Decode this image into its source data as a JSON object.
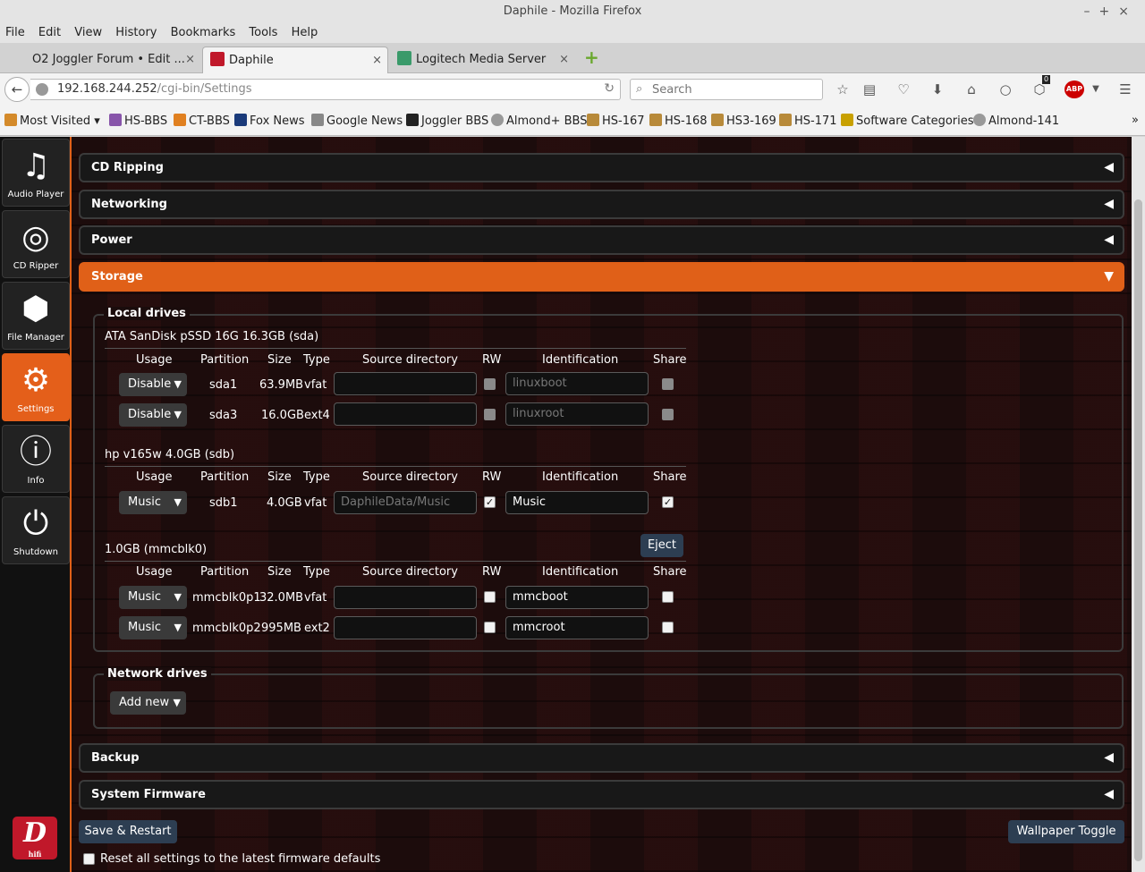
{
  "window": {
    "title": "Daphile - Mozilla Firefox"
  },
  "menu": [
    "File",
    "Edit",
    "View",
    "History",
    "Bookmarks",
    "Tools",
    "Help"
  ],
  "tabs": [
    {
      "label": "O2 Joggler Forum • Edit ..."
    },
    {
      "label": "Daphile"
    },
    {
      "label": "Logitech Media Server"
    }
  ],
  "nav": {
    "url_host": "192.168.244.252",
    "url_path": "/cgi-bin/Settings",
    "search_placeholder": "Search",
    "badge": "0"
  },
  "bookmarks": [
    "Most Visited",
    "HS-BBS",
    "CT-BBS",
    "Fox News",
    "Google News",
    "Joggler BBS",
    "Almond+ BBS",
    "HS-167",
    "HS-168",
    "HS3-169",
    "HS-171",
    "Software Categories",
    "Almond-141"
  ],
  "sidebar": [
    {
      "label": "Audio Player"
    },
    {
      "label": "CD Ripper"
    },
    {
      "label": "File Manager"
    },
    {
      "label": "Settings"
    },
    {
      "label": "Info"
    },
    {
      "label": "Shutdown"
    }
  ],
  "logo": {
    "text": "D",
    "sub": "hifi"
  },
  "sections": {
    "cd_ripping": "CD Ripping",
    "networking": "Networking",
    "power": "Power",
    "storage": "Storage",
    "backup": "Backup",
    "firmware": "System Firmware"
  },
  "storage": {
    "local_legend": "Local drives",
    "network_legend": "Network drives",
    "headers": {
      "usage": "Usage",
      "partition": "Partition",
      "size": "Size",
      "type": "Type",
      "source": "Source directory",
      "rw": "RW",
      "ident": "Identification",
      "share": "Share"
    },
    "drives": [
      {
        "title": "ATA SanDisk pSSD 16G 16.3GB (sda)",
        "rows": [
          {
            "usage": "Disable",
            "partition": "sda1",
            "size": "63.9MB",
            "type": "vfat",
            "source": "",
            "ident": "linuxboot"
          },
          {
            "usage": "Disable",
            "partition": "sda3",
            "size": "16.0GB",
            "type": "ext4",
            "source": "",
            "ident": "linuxroot"
          }
        ]
      },
      {
        "title": "hp v165w 4.0GB (sdb)",
        "rows": [
          {
            "usage": "Music",
            "partition": "sdb1",
            "size": "4.0GB",
            "type": "vfat",
            "source": "DaphileData/Music",
            "ident": "Music"
          }
        ]
      },
      {
        "title": "1.0GB (mmcblk0)",
        "eject": "Eject",
        "rows": [
          {
            "usage": "Music",
            "partition": "mmcblk0p1",
            "size": "32.0MB",
            "type": "vfat",
            "source": "",
            "ident": "mmcboot"
          },
          {
            "usage": "Music",
            "partition": "mmcblk0p2",
            "size": "995MB",
            "type": "ext2",
            "source": "",
            "ident": "mmcroot"
          }
        ]
      }
    ],
    "add_new": "Add new"
  },
  "footer": {
    "save": "Save & Restart",
    "wallpaper": "Wallpaper Toggle",
    "reset_label": "Reset all settings to the latest firmware defaults"
  }
}
